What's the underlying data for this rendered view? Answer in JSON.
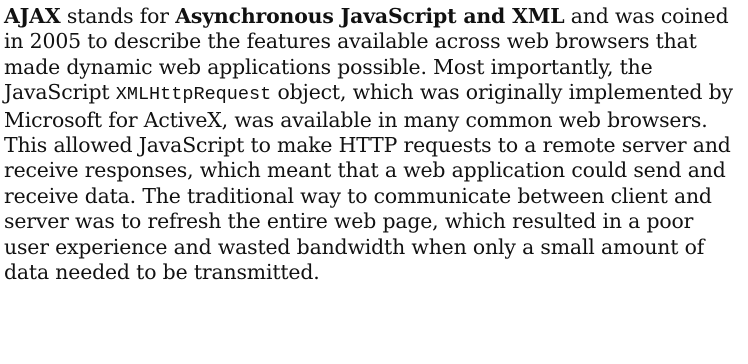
{
  "paragraph": {
    "term": "AJAX",
    "text_1": " stands for ",
    "expansion": "Asynchronous JavaScript and XML",
    "text_2": " and was coined in 2005 to describe the features available across web browsers that made dynamic web applications possible. Most importantly, the JavaScript ",
    "code": "XMLHttpRequest",
    "text_3": " object, which was originally implemented by Microsoft for ActiveX, was available in many common web browsers. This allowed JavaScript to make HTTP requests to a remote server and receive responses, which meant that a web application could send and receive data. The traditional way to communicate between client and server was to refresh the entire web page, which resulted in a poor user experience and wasted bandwidth when only a small amount of data needed to be transmitted."
  }
}
